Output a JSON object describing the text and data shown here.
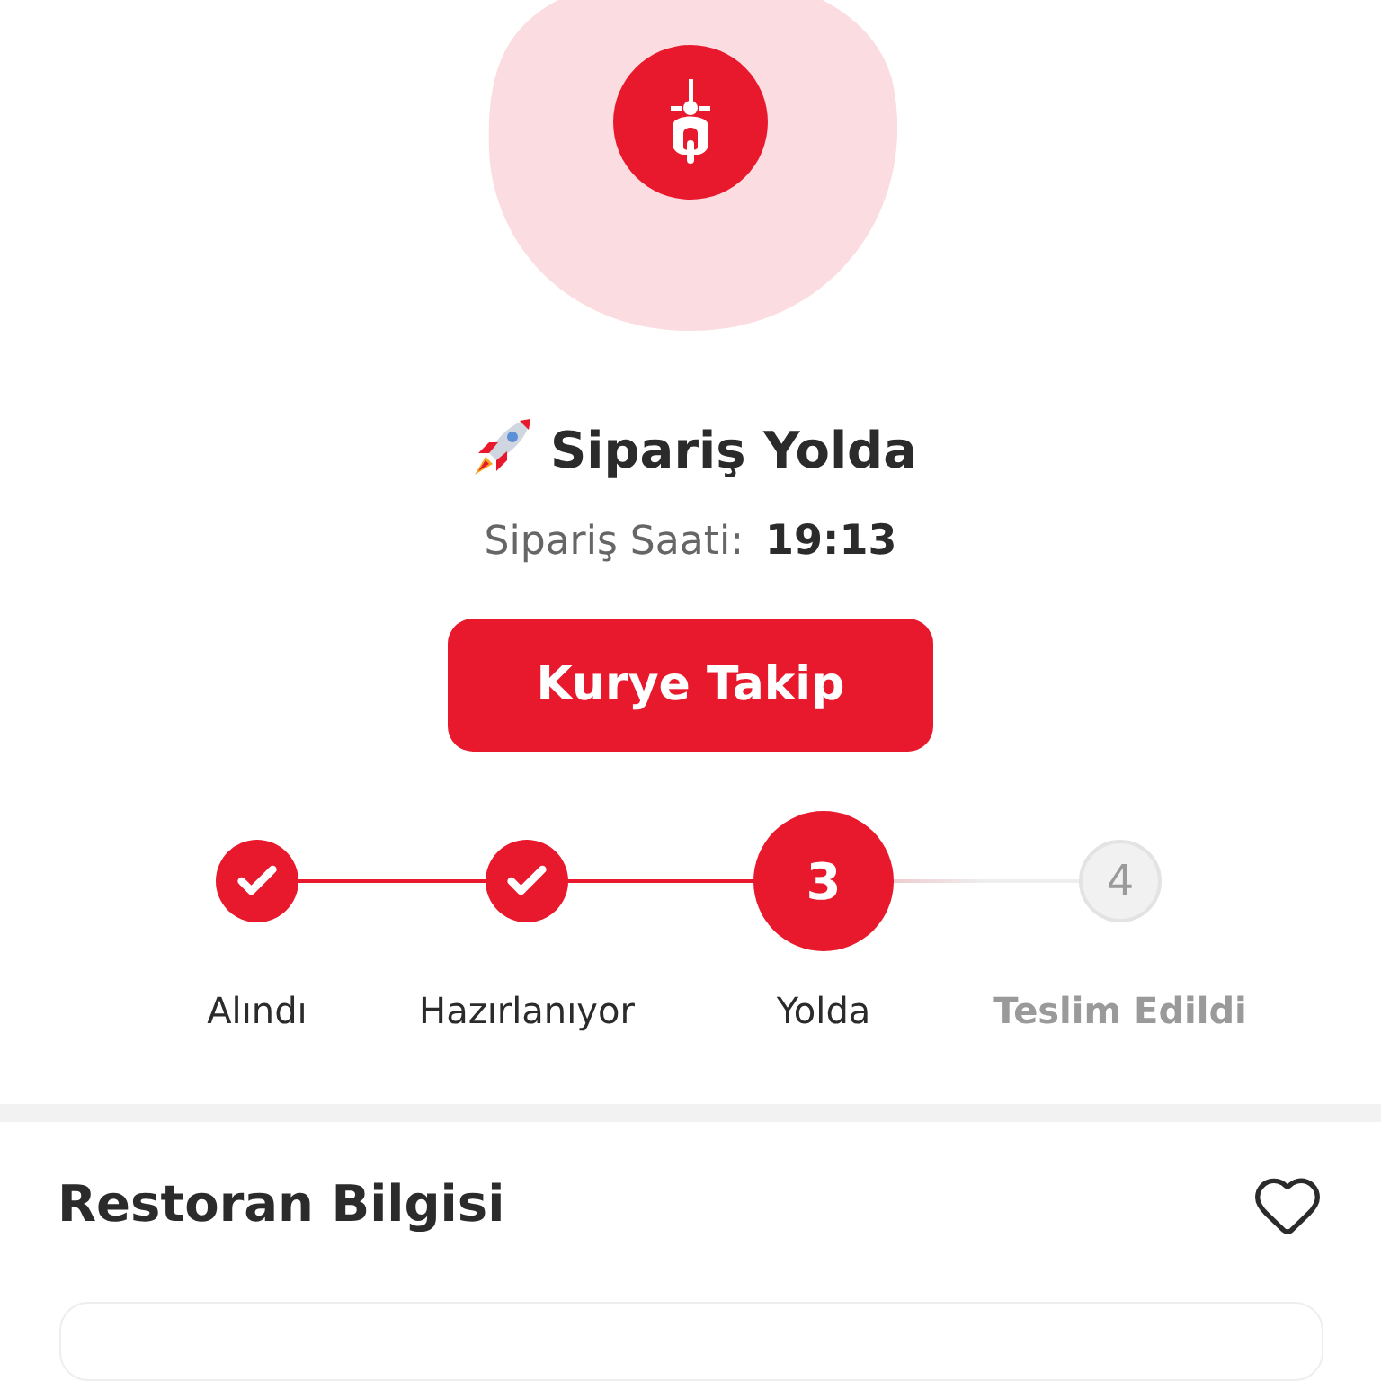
{
  "status": {
    "title": "Sipariş Yolda",
    "time_label": "Sipariş Saati:",
    "time": "19:13"
  },
  "track_button": "Kurye Takip",
  "steps": [
    {
      "label": "Alındı",
      "kind": "done"
    },
    {
      "label": "Hazırlanıyor",
      "kind": "done"
    },
    {
      "label": "Yolda",
      "kind": "current",
      "number": "3"
    },
    {
      "label": "Teslim Edildi",
      "kind": "pending",
      "number": "4"
    }
  ],
  "restaurant": {
    "title": "Restoran Bilgisi",
    "favorite": false
  }
}
